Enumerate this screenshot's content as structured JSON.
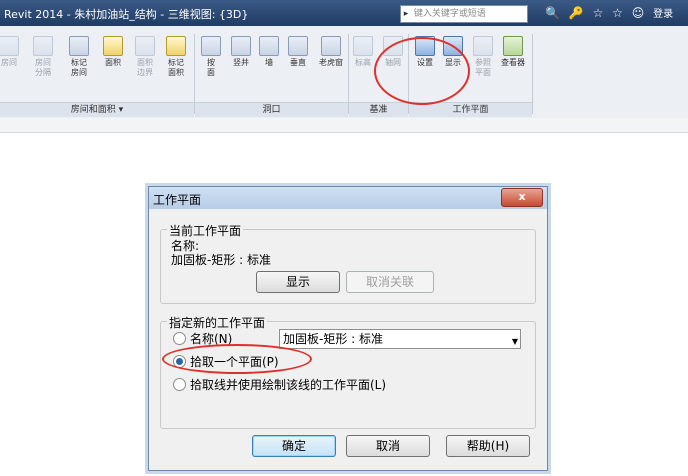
{
  "titlebar": {
    "app_title": "Revit 2014 -   朱村加油站_结构 - 三维视图: {3D}",
    "search_placeholder": "键入关键字或短语",
    "search_arrow": "▸",
    "icons": [
      "binoculars-icon",
      "key-icon",
      "star-outline-icon",
      "star-icon",
      "user-icon"
    ],
    "icon_glyphs": [
      "🔍",
      "🔑",
      "☆",
      "☆",
      "☺"
    ],
    "login_label": "登录"
  },
  "ribbon": {
    "room_buttons": [
      {
        "label": "房间",
        "dim": true
      },
      {
        "label": "房间\n分隔",
        "dim": true
      },
      {
        "label": "标记\n房间",
        "dim": false
      },
      {
        "label": "面积",
        "dim": false
      },
      {
        "label": "面积\n边界",
        "dim": true
      },
      {
        "label": "标记\n面积",
        "dim": false
      }
    ],
    "opening_buttons": [
      {
        "label": "按\n面"
      },
      {
        "label": "竖井"
      },
      {
        "label": "墙"
      },
      {
        "label": "垂直"
      },
      {
        "label": "老虎窗"
      }
    ],
    "datum_buttons": [
      {
        "label": "标高",
        "dim": true
      },
      {
        "label": "轴网",
        "dim": true
      }
    ],
    "workplane_buttons": [
      {
        "label": "设置",
        "dim": false
      },
      {
        "label": "显示",
        "dim": false
      },
      {
        "label": "参照\n平面",
        "dim": true
      },
      {
        "label": "查看器",
        "dim": false
      }
    ],
    "groups": {
      "room_area": "房间和面积 ▾",
      "opening": "洞口",
      "datum": "基准",
      "workplane": "工作平面"
    }
  },
  "dialog": {
    "title": "工作平面",
    "close_glyph": "x",
    "current": {
      "legend": "当前工作平面",
      "name_label": "名称:",
      "name_value": "加固板-矩形 : 标准",
      "show_button": "显示",
      "disassociate_button": "取消关联"
    },
    "new": {
      "legend": "指定新的工作平面",
      "option_name": "名称(N)",
      "name_select_value": "加固板-矩形 : 标准",
      "option_pick_plane": "拾取一个平面(P)",
      "option_pick_line": "拾取线并使用绘制该线的工作平面(L)",
      "selected": "pick_plane"
    },
    "ok_button": "确定",
    "cancel_button": "取消",
    "help_button": "帮助(H)"
  },
  "colors": {
    "annotation_red": "#e0302a",
    "title_bar": "#1f3b63"
  }
}
